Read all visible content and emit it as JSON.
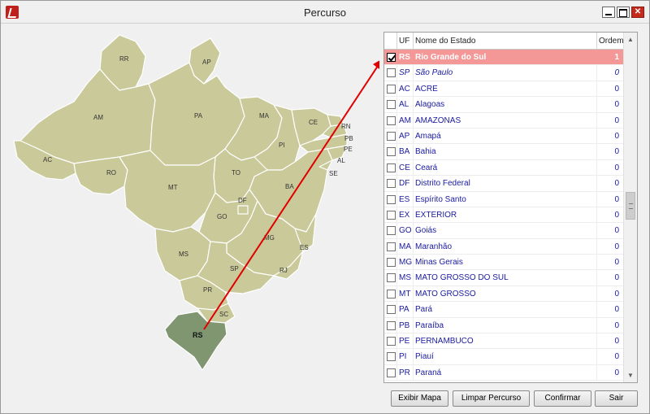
{
  "window": {
    "title": "Percurso"
  },
  "grid": {
    "headers": {
      "uf": "UF",
      "name": "Nome do Estado",
      "order": "Ordem"
    },
    "rows": [
      {
        "uf": "RS",
        "name": "Rio Grande do Sul",
        "order": "1",
        "checked": true,
        "selected": true
      },
      {
        "uf": "SP",
        "name": "São Paulo",
        "order": "0",
        "italic": true
      },
      {
        "uf": "AC",
        "name": "ACRE",
        "order": "0"
      },
      {
        "uf": "AL",
        "name": "Alagoas",
        "order": "0"
      },
      {
        "uf": "AM",
        "name": "AMAZONAS",
        "order": "0"
      },
      {
        "uf": "AP",
        "name": "Amapá",
        "order": "0"
      },
      {
        "uf": "BA",
        "name": "Bahia",
        "order": "0"
      },
      {
        "uf": "CE",
        "name": "Ceará",
        "order": "0"
      },
      {
        "uf": "DF",
        "name": "Distrito Federal",
        "order": "0"
      },
      {
        "uf": "ES",
        "name": "Espírito Santo",
        "order": "0"
      },
      {
        "uf": "EX",
        "name": "EXTERIOR",
        "order": "0"
      },
      {
        "uf": "GO",
        "name": "Goiás",
        "order": "0"
      },
      {
        "uf": "MA",
        "name": "Maranhão",
        "order": "0"
      },
      {
        "uf": "MG",
        "name": "Minas Gerais",
        "order": "0"
      },
      {
        "uf": "MS",
        "name": "MATO GROSSO DO SUL",
        "order": "0"
      },
      {
        "uf": "MT",
        "name": "MATO GROSSO",
        "order": "0"
      },
      {
        "uf": "PA",
        "name": "Pará",
        "order": "0"
      },
      {
        "uf": "PB",
        "name": "Paraíba",
        "order": "0"
      },
      {
        "uf": "PE",
        "name": "PERNAMBUCO",
        "order": "0"
      },
      {
        "uf": "PI",
        "name": "Piauí",
        "order": "0"
      },
      {
        "uf": "PR",
        "name": "Paraná",
        "order": "0"
      }
    ]
  },
  "map": {
    "labels": {
      "rr": "RR",
      "ap": "AP",
      "am": "AM",
      "pa": "PA",
      "ma": "MA",
      "ce": "CE",
      "rn": "RN",
      "pb": "PB",
      "pe": "PE",
      "al": "AL",
      "se": "SE",
      "pi": "PI",
      "ac": "AC",
      "ro": "RO",
      "mt": "MT",
      "to": "TO",
      "ba": "BA",
      "df": "DF",
      "go": "GO",
      "mg": "MG",
      "es": "ES",
      "ms": "MS",
      "sp": "SP",
      "rj": "RJ",
      "pr": "PR",
      "sc": "SC",
      "rs": "RS"
    },
    "colors": {
      "land": "#c9c99a",
      "border": "#ffffff",
      "selected": "#7f9671",
      "route": "#e00000"
    }
  },
  "buttons": {
    "exibir_mapa": "Exibir Mapa",
    "limpar_percurso": "Limpar Percurso",
    "confirmar": "Confirmar",
    "sair": "Sair"
  }
}
